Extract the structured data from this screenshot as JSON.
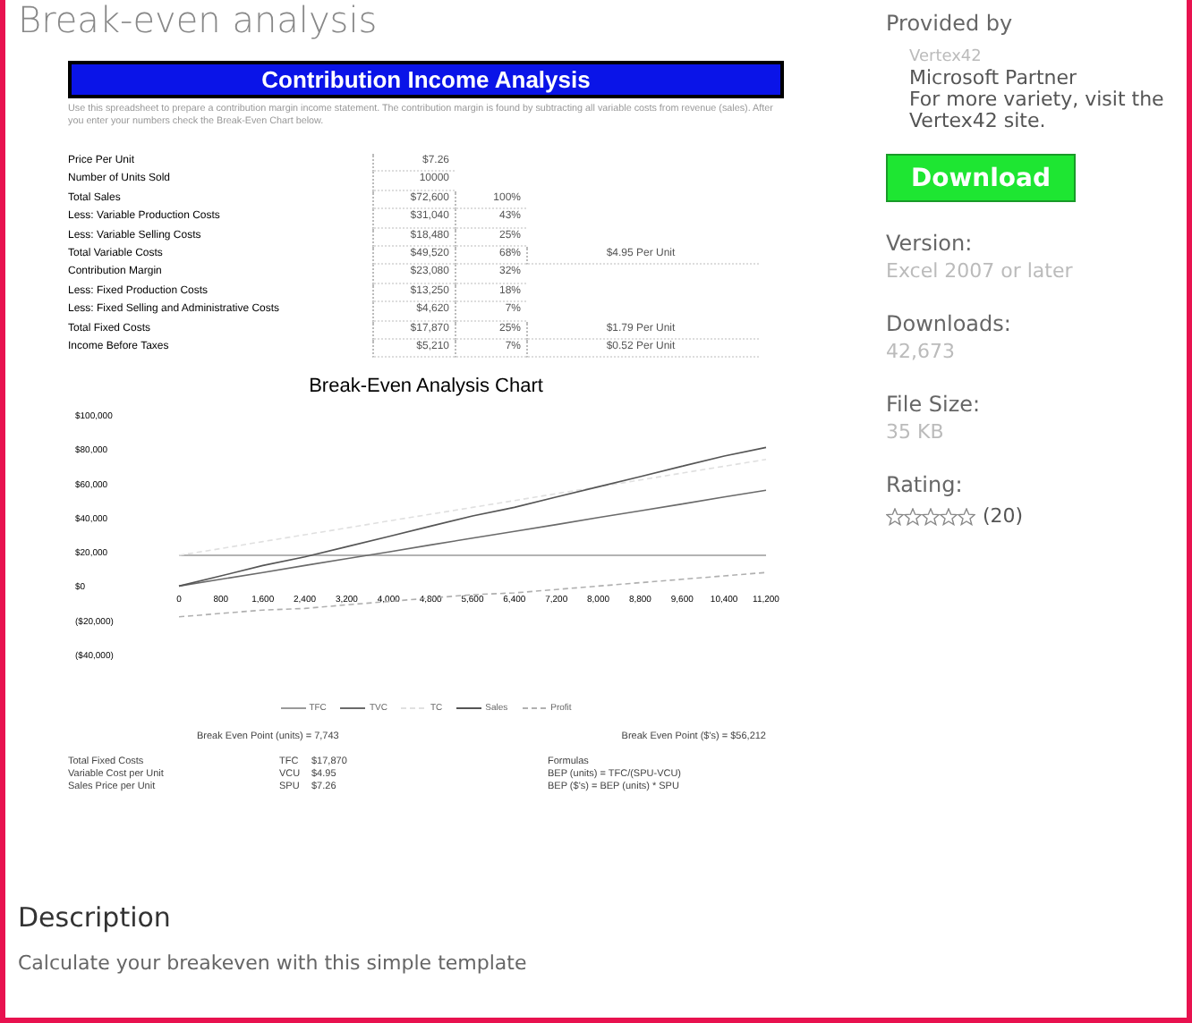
{
  "page_title": "Break-even analysis",
  "sheet": {
    "title": "Contribution Income Analysis",
    "intro": "Use this spreadsheet to prepare a contribution margin income statement. The contribution margin is found by subtracting all variable costs from revenue (sales). After you enter your numbers check the Break-Even Chart below.",
    "rows": [
      {
        "label": "Price Per Unit",
        "value": "$7.26",
        "percent": "",
        "per_unit": ""
      },
      {
        "label": "Number of Units Sold",
        "value": "10000",
        "percent": "",
        "per_unit": ""
      },
      {
        "label": "Total Sales",
        "value": "$72,600",
        "percent": "100%",
        "per_unit": ""
      },
      {
        "label": "Less: Variable Production Costs",
        "value": "$31,040",
        "percent": "43%",
        "per_unit": ""
      },
      {
        "label": "Less: Variable Selling Costs",
        "value": "$18,480",
        "percent": "25%",
        "per_unit": ""
      },
      {
        "label": "Total Variable Costs",
        "value": "$49,520",
        "percent": "68%",
        "per_unit": "$4.95  Per Unit"
      },
      {
        "label": "Contribution Margin",
        "value": "$23,080",
        "percent": "32%",
        "per_unit": ""
      },
      {
        "label": "Less: Fixed Production Costs",
        "value": "$13,250",
        "percent": "18%",
        "per_unit": ""
      },
      {
        "label": "Less: Fixed Selling and Administrative Costs",
        "value": "$4,620",
        "percent": "7%",
        "per_unit": ""
      },
      {
        "label": "Total Fixed Costs",
        "value": "$17,870",
        "percent": "25%",
        "per_unit": "$1.79  Per Unit"
      },
      {
        "label": "Income Before Taxes",
        "value": "$5,210",
        "percent": "7%",
        "per_unit": "$0.52  Per Unit"
      }
    ],
    "chart_data": {
      "type": "line",
      "title": "Break-Even Analysis Chart",
      "categories": [
        "0",
        "800",
        "1,600",
        "2,400",
        "3,200",
        "4,000",
        "4,800",
        "5,600",
        "6,400",
        "7,200",
        "8,000",
        "8,800",
        "9,600",
        "10,400",
        "11,200"
      ],
      "series": [
        {
          "name": "TFC",
          "color": "#9a9a9a",
          "line_style": "solid",
          "values": [
            18000,
            18000,
            18000,
            18000,
            18000,
            18000,
            18000,
            18000,
            18000,
            18000,
            18000,
            18000,
            18000,
            18000,
            18000
          ]
        },
        {
          "name": "TVC",
          "color": "#6a6a6a",
          "line_style": "solid",
          "values": [
            0,
            4000,
            8000,
            12000,
            16000,
            20000,
            24000,
            28000,
            32000,
            36000,
            40000,
            44000,
            48000,
            52000,
            56000
          ]
        },
        {
          "name": "TC",
          "color": "#e0e0e0",
          "line_style": "dashed",
          "values": [
            18000,
            22000,
            26000,
            30000,
            34000,
            38000,
            42000,
            46000,
            50000,
            54000,
            58000,
            62000,
            66000,
            70000,
            74000
          ]
        },
        {
          "name": "Sales",
          "color": "#555555",
          "line_style": "solid",
          "values": [
            0,
            6000,
            12000,
            17000,
            23000,
            29000,
            35000,
            41000,
            46000,
            52000,
            58000,
            64000,
            70000,
            76000,
            81000
          ]
        },
        {
          "name": "Profit",
          "color": "#b0b0b0",
          "line_style": "dashed",
          "values": [
            -18000,
            -16000,
            -14000,
            -13000,
            -11000,
            -9000,
            -7000,
            -5000,
            -4000,
            -2000,
            0,
            2000,
            4000,
            6000,
            8000
          ]
        }
      ],
      "ylim": [
        -40000,
        100000
      ],
      "yticks": [
        {
          "value": 100000,
          "label": "$100,000"
        },
        {
          "value": 80000,
          "label": "$80,000"
        },
        {
          "value": 60000,
          "label": "$60,000"
        },
        {
          "value": 40000,
          "label": "$40,000"
        },
        {
          "value": 20000,
          "label": "$20,000"
        },
        {
          "value": 0,
          "label": "$0"
        },
        {
          "value": -20000,
          "label": "($20,000)"
        },
        {
          "value": -40000,
          "label": "($40,000)"
        }
      ]
    },
    "break_even_units": "Break Even Point (units) = 7,743",
    "break_even_dollars": "Break Even Point ($'s) = $56,212",
    "inputs": [
      {
        "label": "Total Fixed Costs",
        "code": "TFC",
        "value": "$17,870",
        "note": "Formulas"
      },
      {
        "label": "Variable Cost per Unit",
        "code": "VCU",
        "value": "$4.95",
        "note": "BEP (units) = TFC/(SPU-VCU)"
      },
      {
        "label": "Sales Price per Unit",
        "code": "SPU",
        "value": "$7.26",
        "note": "BEP ($'s) = BEP (units) * SPU"
      }
    ]
  },
  "description": {
    "heading": "Description",
    "text": "Calculate your breakeven with this simple template"
  },
  "sidebar": {
    "provided_by": "Provided by",
    "provider": "Vertex42",
    "partner": "Microsoft Partner",
    "visit": "For more variety, visit the Vertex42 site.",
    "download": "Download",
    "facts": [
      {
        "label": "Version:",
        "value": "Excel 2007 or later"
      },
      {
        "label": "Downloads:",
        "value": "42,673"
      },
      {
        "label": "File Size:",
        "value": "35 KB"
      }
    ],
    "rating_label": "Rating:",
    "stars": 0,
    "rating_count": "(20)"
  }
}
